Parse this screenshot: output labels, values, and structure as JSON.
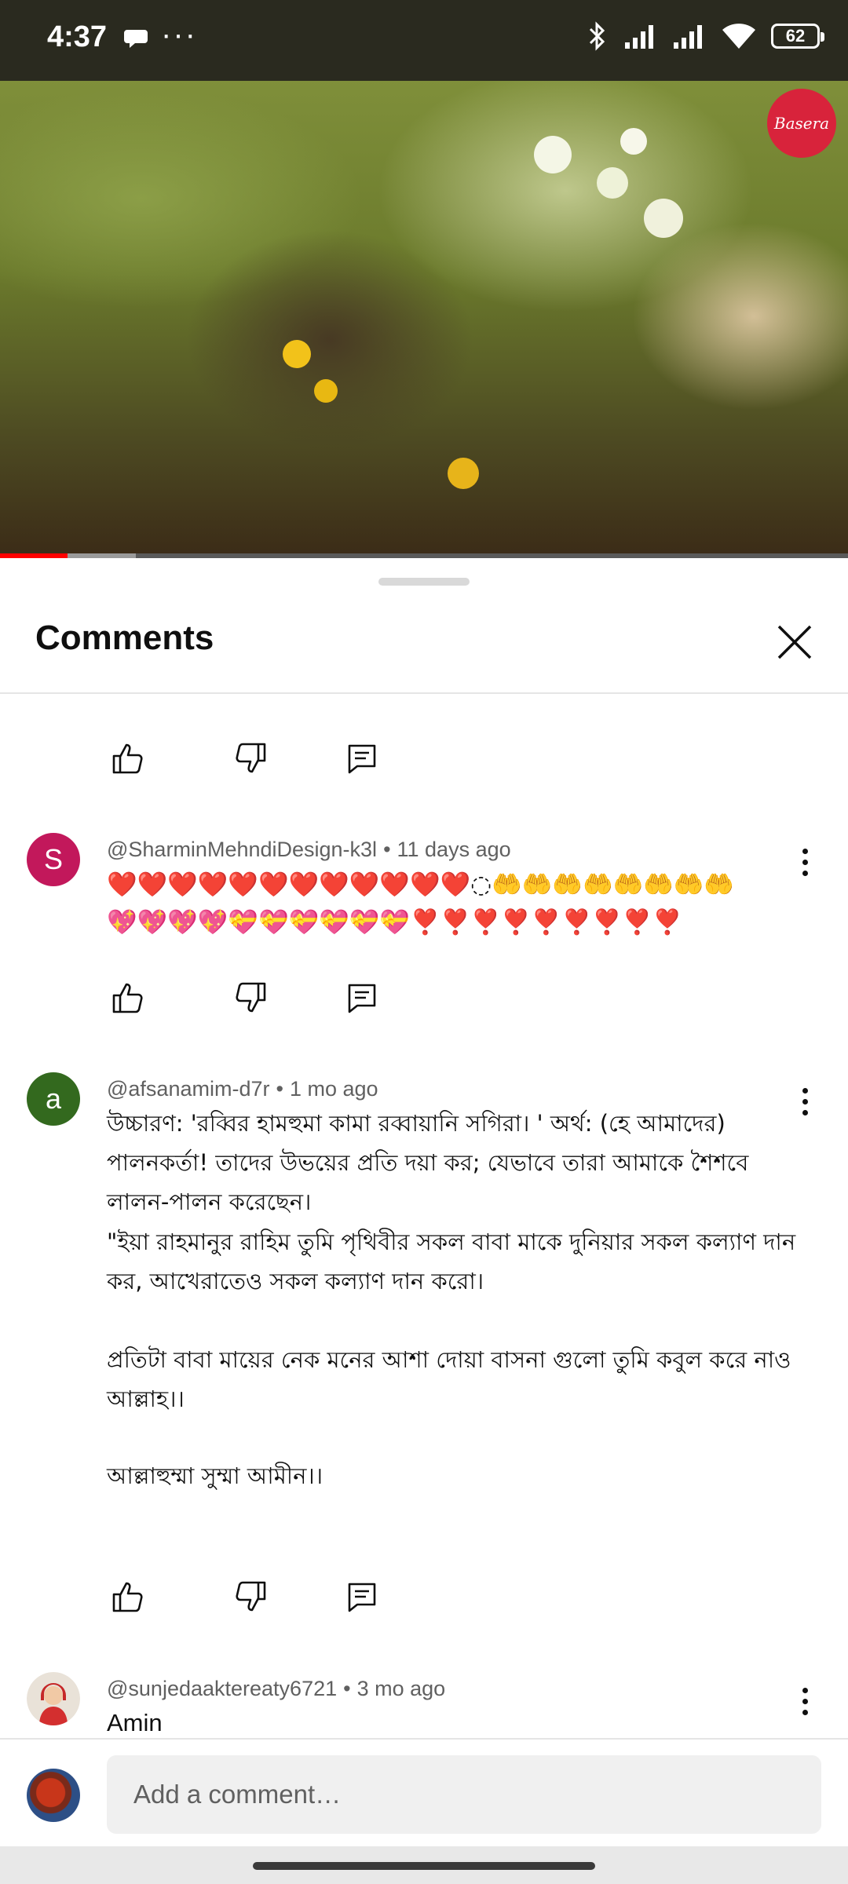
{
  "status_bar": {
    "time": "4:37",
    "battery": "62"
  },
  "video": {
    "channel_logo_text": "Basera",
    "progress_played": 0.08,
    "progress_buffered": 0.16
  },
  "sheet": {
    "title": "Comments"
  },
  "comments": [
    {
      "avatar_letter": "S",
      "avatar_color": "#c2185b",
      "author": "@SharminMehndiDesign-k3l",
      "age": "11 days ago",
      "emoji_line_1": "❤️❤️❤️❤️❤️❤️❤️❤️❤️❤️❤️❤️◌🤲🤲🤲🤲🤲🤲🤲🤲",
      "emoji_line_2": "💖💖💖💖💝💝💝💝💝💝❣️❣️❣️❣️❣️❣️❣️❣️❣️"
    },
    {
      "avatar_letter": "a",
      "avatar_color": "#33691e",
      "author": "@afsanamim-d7r",
      "age": "1 mo ago",
      "paragraph_1": "উচ্চারণ: 'রব্বির হামহুমা কামা রব্বায়ানি সগিরা। ' অর্থ: (হে আমাদের) পালনকর্তা! তাদের উভয়ের প্রতি দয়া কর; যেভাবে তারা আমাকে শৈশবে লালন-পালন করেছেন।",
      "paragraph_2": "\"ইয়া রাহমানুর রাহিম তুমি পৃথিবীর সকল বাবা মাকে দুনিয়ার সকল কল্যাণ দান কর,  আখেরাতেও সকল কল্যাণ দান করো।",
      "paragraph_3": "প্রতিটা বাবা মায়ের নেক মনের আশা দোয়া বাসনা গুলো তুমি কবুল করে নাও আল্লাহ।।",
      "paragraph_4": "আল্লাহুম্মা সুম্মা আমীন।।"
    },
    {
      "author": "@sunjedaaktereaty6721",
      "age": "3 mo ago",
      "text": "Amin"
    }
  ],
  "composer": {
    "placeholder": "Add a comment…"
  },
  "colors": {
    "accent_red": "#ff0000",
    "secondary_text": "#606060"
  }
}
